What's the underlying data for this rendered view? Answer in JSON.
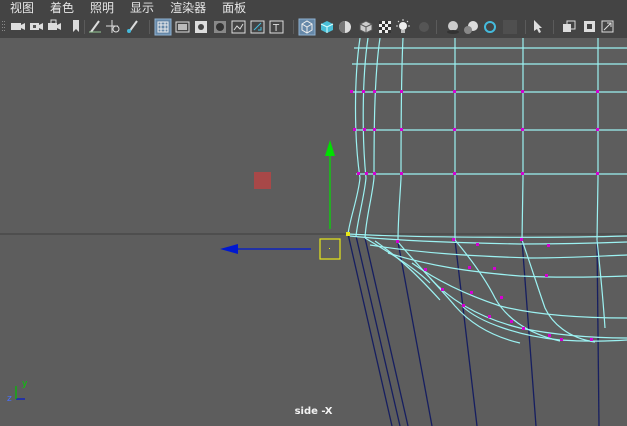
{
  "menubar": {
    "items": [
      "视图",
      "着色",
      "照明",
      "显示",
      "渲染器",
      "面板"
    ]
  },
  "toolbar": {
    "icons": [
      "camera-icon",
      "camera-attribute-icon",
      "camera-lock-icon",
      "bookmark-icon",
      "grease-pencil-icon",
      "pan-zoom-icon",
      "paint-brush-icon",
      "grid-icon",
      "film-gate-icon",
      "resolution-gate-icon",
      "gate-mask-icon",
      "field-chart-icon",
      "safe-action-icon",
      "safe-title-icon",
      "wireframe-cube-icon",
      "smooth-shade-cube-icon",
      "shade-ball-icon",
      "wireframe-on-shaded-icon",
      "checker-icon",
      "light-bulb-icon",
      "shadow-icon",
      "ambient-occlusion-icon",
      "motion-blur-icon",
      "anti-alias-icon",
      "depth-of-field-icon",
      "isolate-select-icon",
      "xray-icon",
      "xray-joints-icon",
      "xray-components-icon"
    ]
  },
  "viewport": {
    "label": "side -X",
    "axis_y": "y",
    "axis_z": "z"
  },
  "colors": {
    "background": "#5d5d5d",
    "wire": "#9cf2f2",
    "vertex": "#d400d4",
    "manip_y": "#00e000",
    "manip_z": "#0018d0",
    "manip_center": "#e6e619",
    "pivot": "#a84848",
    "curves": "#161e60"
  }
}
